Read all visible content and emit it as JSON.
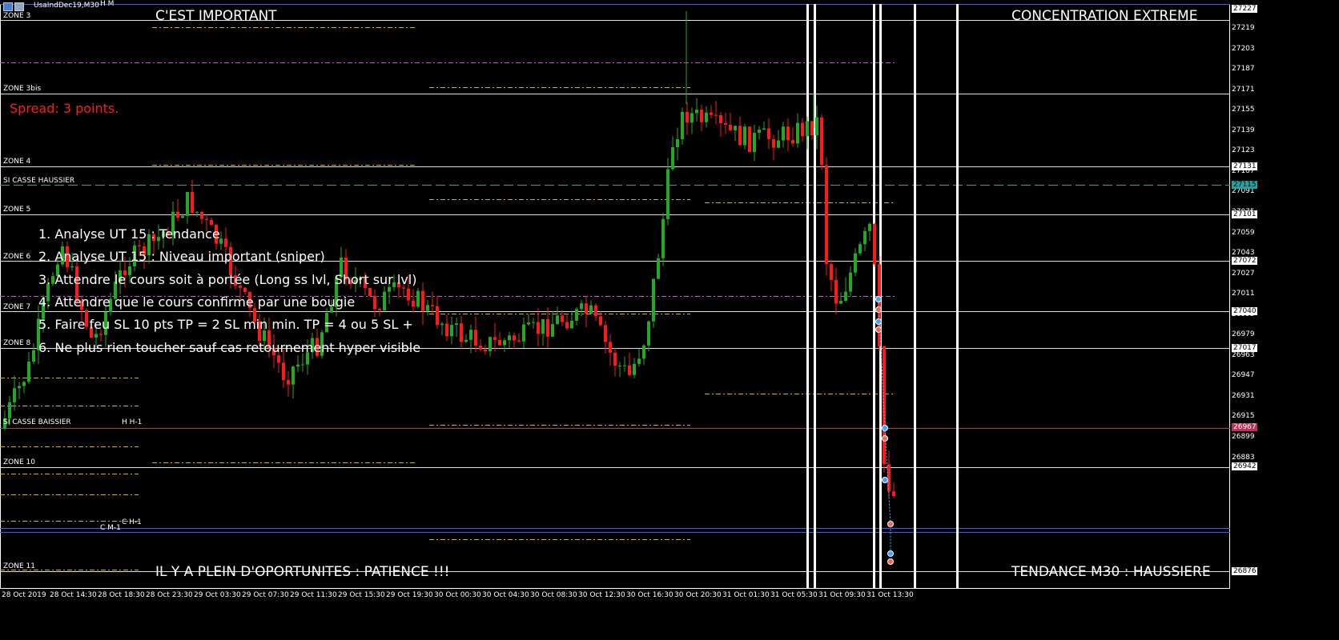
{
  "window": {
    "title": "UsaIndDec19,M30",
    "period_marker": "H M"
  },
  "notes": {
    "top_left": "C'EST IMPORTANT",
    "top_right": "CONCENTRATION EXTREME",
    "bottom_left": "IL Y A PLEIN D'OPORTUNITES : PATIENCE !!!",
    "bottom_right": "TENDANCE M30 : HAUSSIERE",
    "spread": "Spread: 3 points."
  },
  "rules": [
    "1. Analyse UT 15 : Tendance",
    "2. Analyse UT 15 : Niveau important (sniper)",
    "3. Attendre le cours soit à portée (Long ss lvl, Short sur lvl)",
    "4. Attendre que le cours confirme par une bougie",
    "5. Faire feu SL 10 pts TP = 2 SL min min. TP = 4 ou 5 SL +",
    "6. Ne plus rien toucher sauf cas retournement hyper visible"
  ],
  "zones": {
    "zone3": "ZONE 3",
    "zone3bis": "ZONE 3bis",
    "zone4": "ZONE 4",
    "si_casse_haussier": "SI CASSE HAUSSIER",
    "zone5": "ZONE 5",
    "zone6": "ZONE 6",
    "zone7": "ZONE 7",
    "zone8": "ZONE 8",
    "si_casse_baissier": "SI CASSE BAISSIER",
    "zone10": "ZONE 10",
    "zone11": "ZONE 11"
  },
  "level_marks": {
    "hh1": "H H-1",
    "ch1": "C H-1",
    "cm1": "C M-1"
  },
  "price_axis": [
    "27219",
    "27203",
    "27187",
    "27171",
    "27155",
    "27139",
    "27123",
    "27107",
    "27091",
    "27075",
    "27059",
    "27043",
    "27027",
    "27011",
    "26995",
    "26979",
    "26963",
    "26947",
    "26931",
    "26915",
    "26899",
    "26883"
  ],
  "price_tags": {
    "top": "27227",
    "p27131": "27131",
    "p27115": "27115",
    "p27101": "27101",
    "p27072": "27072",
    "p27040": "27040",
    "p27017": "27017",
    "p26967": "26967",
    "p26942": "26942",
    "p26876": "26876"
  },
  "time_axis": [
    "28 Oct 2019",
    "28 Oct 14:30",
    "28 Oct 18:30",
    "28 Oct 23:30",
    "29 Oct 03:30",
    "29 Oct 07:30",
    "29 Oct 11:30",
    "29 Oct 15:30",
    "29 Oct 19:30",
    "30 Oct 00:30",
    "30 Oct 04:30",
    "30 Oct 08:30",
    "30 Oct 12:30",
    "30 Oct 16:30",
    "30 Oct 20:30",
    "31 Oct 01:30",
    "31 Oct 05:30",
    "31 Oct 09:30",
    "31 Oct 13:30"
  ],
  "colors": {
    "background": "#000000",
    "bull": "#22aa22",
    "bear": "#ff1a1a",
    "zone_line": "#ffffff",
    "dash_level": "#d4b020",
    "purple_level": "#c05cd0",
    "cyan_level": "#1fa3a3",
    "blue_level": "#3d5cff",
    "red_level": "#c0305a",
    "spread_text": "#ff1a1a"
  }
}
